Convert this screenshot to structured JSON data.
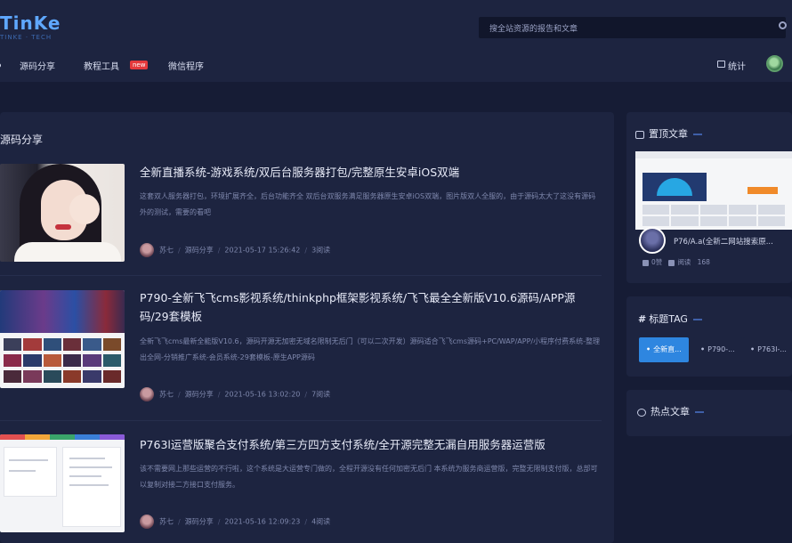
{
  "header": {
    "logo": "TinKe",
    "search_placeholder": "搜全站资源的报告和文章",
    "nav": [
      {
        "label": "源码分享"
      },
      {
        "label": "教程工具",
        "badge": "new"
      },
      {
        "label": "微信程序"
      }
    ],
    "stats_label": "统计"
  },
  "main": {
    "section_title": "源码分享",
    "posts": [
      {
        "title": "全新直播系统-游戏系统/双后台服务器打包/完整原生安卓iOS双端",
        "desc": "这套双人服务器打包，环境扩展齐全，后台功能齐全 双后台双服务满足服务器原生安卓iOS双端，图片版双人全服的，由于源码太大了这没有源码外的测试，需要的看吧",
        "author": "苏七",
        "category": "源码分享",
        "date": "2021-05-17 15:26:42",
        "reads": "3阅读"
      },
      {
        "title": "P790-全新飞飞cms影视系统/thinkphp框架影视系统/飞飞最全全新版V10.6源码/APP源码/29套模板",
        "desc": "全新飞飞cms最新全能版V10.6，源码开源无加密无域名限制无后门（可以二次开发）源码适合飞飞cms源码+PC/WAP/APP/小程序付费系统-整理出全网-分销推广系统-会员系统-29套模板-原生APP源码",
        "author": "苏七",
        "category": "源码分享",
        "date": "2021-05-16 13:02:20",
        "reads": "7阅读"
      },
      {
        "title": "P763l运营版聚合支付系统/第三方四方支付系统/全开源完整无漏自用服务器运营版",
        "desc": "该不需要网上那些运营的不行啦，这个系统是大运营专门做的，全程开源没有任何加密无后门 本系统为服务商运营版，完整无限制支付版，总部可以复制对接二方接口支付服务。",
        "author": "苏七",
        "category": "源码分享",
        "date": "2021-05-16 12:09:23",
        "reads": "4阅读"
      }
    ]
  },
  "sidebar": {
    "top_articles": {
      "heading": "置顶文章",
      "title": "P76/A.a(全新二网站搜索原...",
      "meta1": "0赞",
      "meta2": "阅读",
      "meta3": "168"
    },
    "tags": {
      "heading": "标题TAG",
      "items": [
        "全新直...",
        "P790-...",
        "P763l-..."
      ]
    },
    "hot": {
      "heading": "热点文章"
    }
  }
}
